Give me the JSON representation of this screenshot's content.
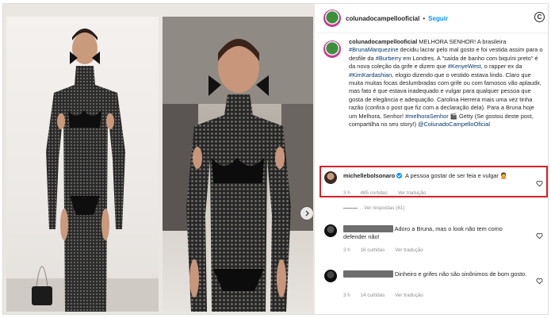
{
  "post": {
    "username": "colunadocampellooficial",
    "separator": "•",
    "follow_label": "Seguir",
    "copyright_icon": "copyright-icon",
    "next_icon": "chevron-right-icon"
  },
  "caption": {
    "username": "colunadocampellooficial",
    "text_1": " MELHORA SENHOR! A brasileira ",
    "tag_1": "#BrunaMarquezine",
    "text_2": " decidiu lacrar pelo mal gosto e foi vestida assim para o desfile da ",
    "tag_2": "#Burberry",
    "text_3": " em Londres. A \"saída de banho com biquíni preto\" é da nova coleção da grife e dizem que ",
    "tag_3": "#KenyeWest",
    "text_4": ", o rapper ex da ",
    "tag_4": "#KimKardashian",
    "text_5": ", elogio dizendo que o vestido estava lindo. Claro que muita muitas focas deslumbradas com grife ou com famosos vão aplaudir, mas fato é que estava inadequado e vulgar para qualquer pessoa que gosta de elegância e adequação. Carolina Herrera mais uma vez tinha razão (confira o post que fiz com a declaração dela). Para a Bruna hoje um Melhora, Senhor! ",
    "tag_5": "#melhoraSenhor",
    "text_6": " 🎬 Getty (Se gostou deste post, compartilha no seu story!) ",
    "tag_6": "@ColunadoCampelloOficial"
  },
  "comments": [
    {
      "username": "michellebolsonaro",
      "verified": true,
      "text": "A pessoa gostar de ser feia e vulgar 🤦",
      "time": "3 h",
      "likes": "485 curtidas",
      "translate": "Ver tradução",
      "replies": "Ver respostas (61)"
    },
    {
      "username": "████████████",
      "text": "Adoro a Bruna, mas o look não tem como defender não!",
      "time": "3 h",
      "likes": "16 curtidas",
      "translate": "Ver tradução"
    },
    {
      "username": "████████████",
      "text": "Dinheiro e grifes não são sinônimos de bom gosto.",
      "time": "3 h",
      "likes": "14 curtidas",
      "translate": "Ver tradução"
    }
  ],
  "colors": {
    "link_blue": "#0095f6",
    "tag_blue": "#00376b",
    "highlight_red": "#d8202a",
    "meta_gray": "#8e8e8e"
  }
}
